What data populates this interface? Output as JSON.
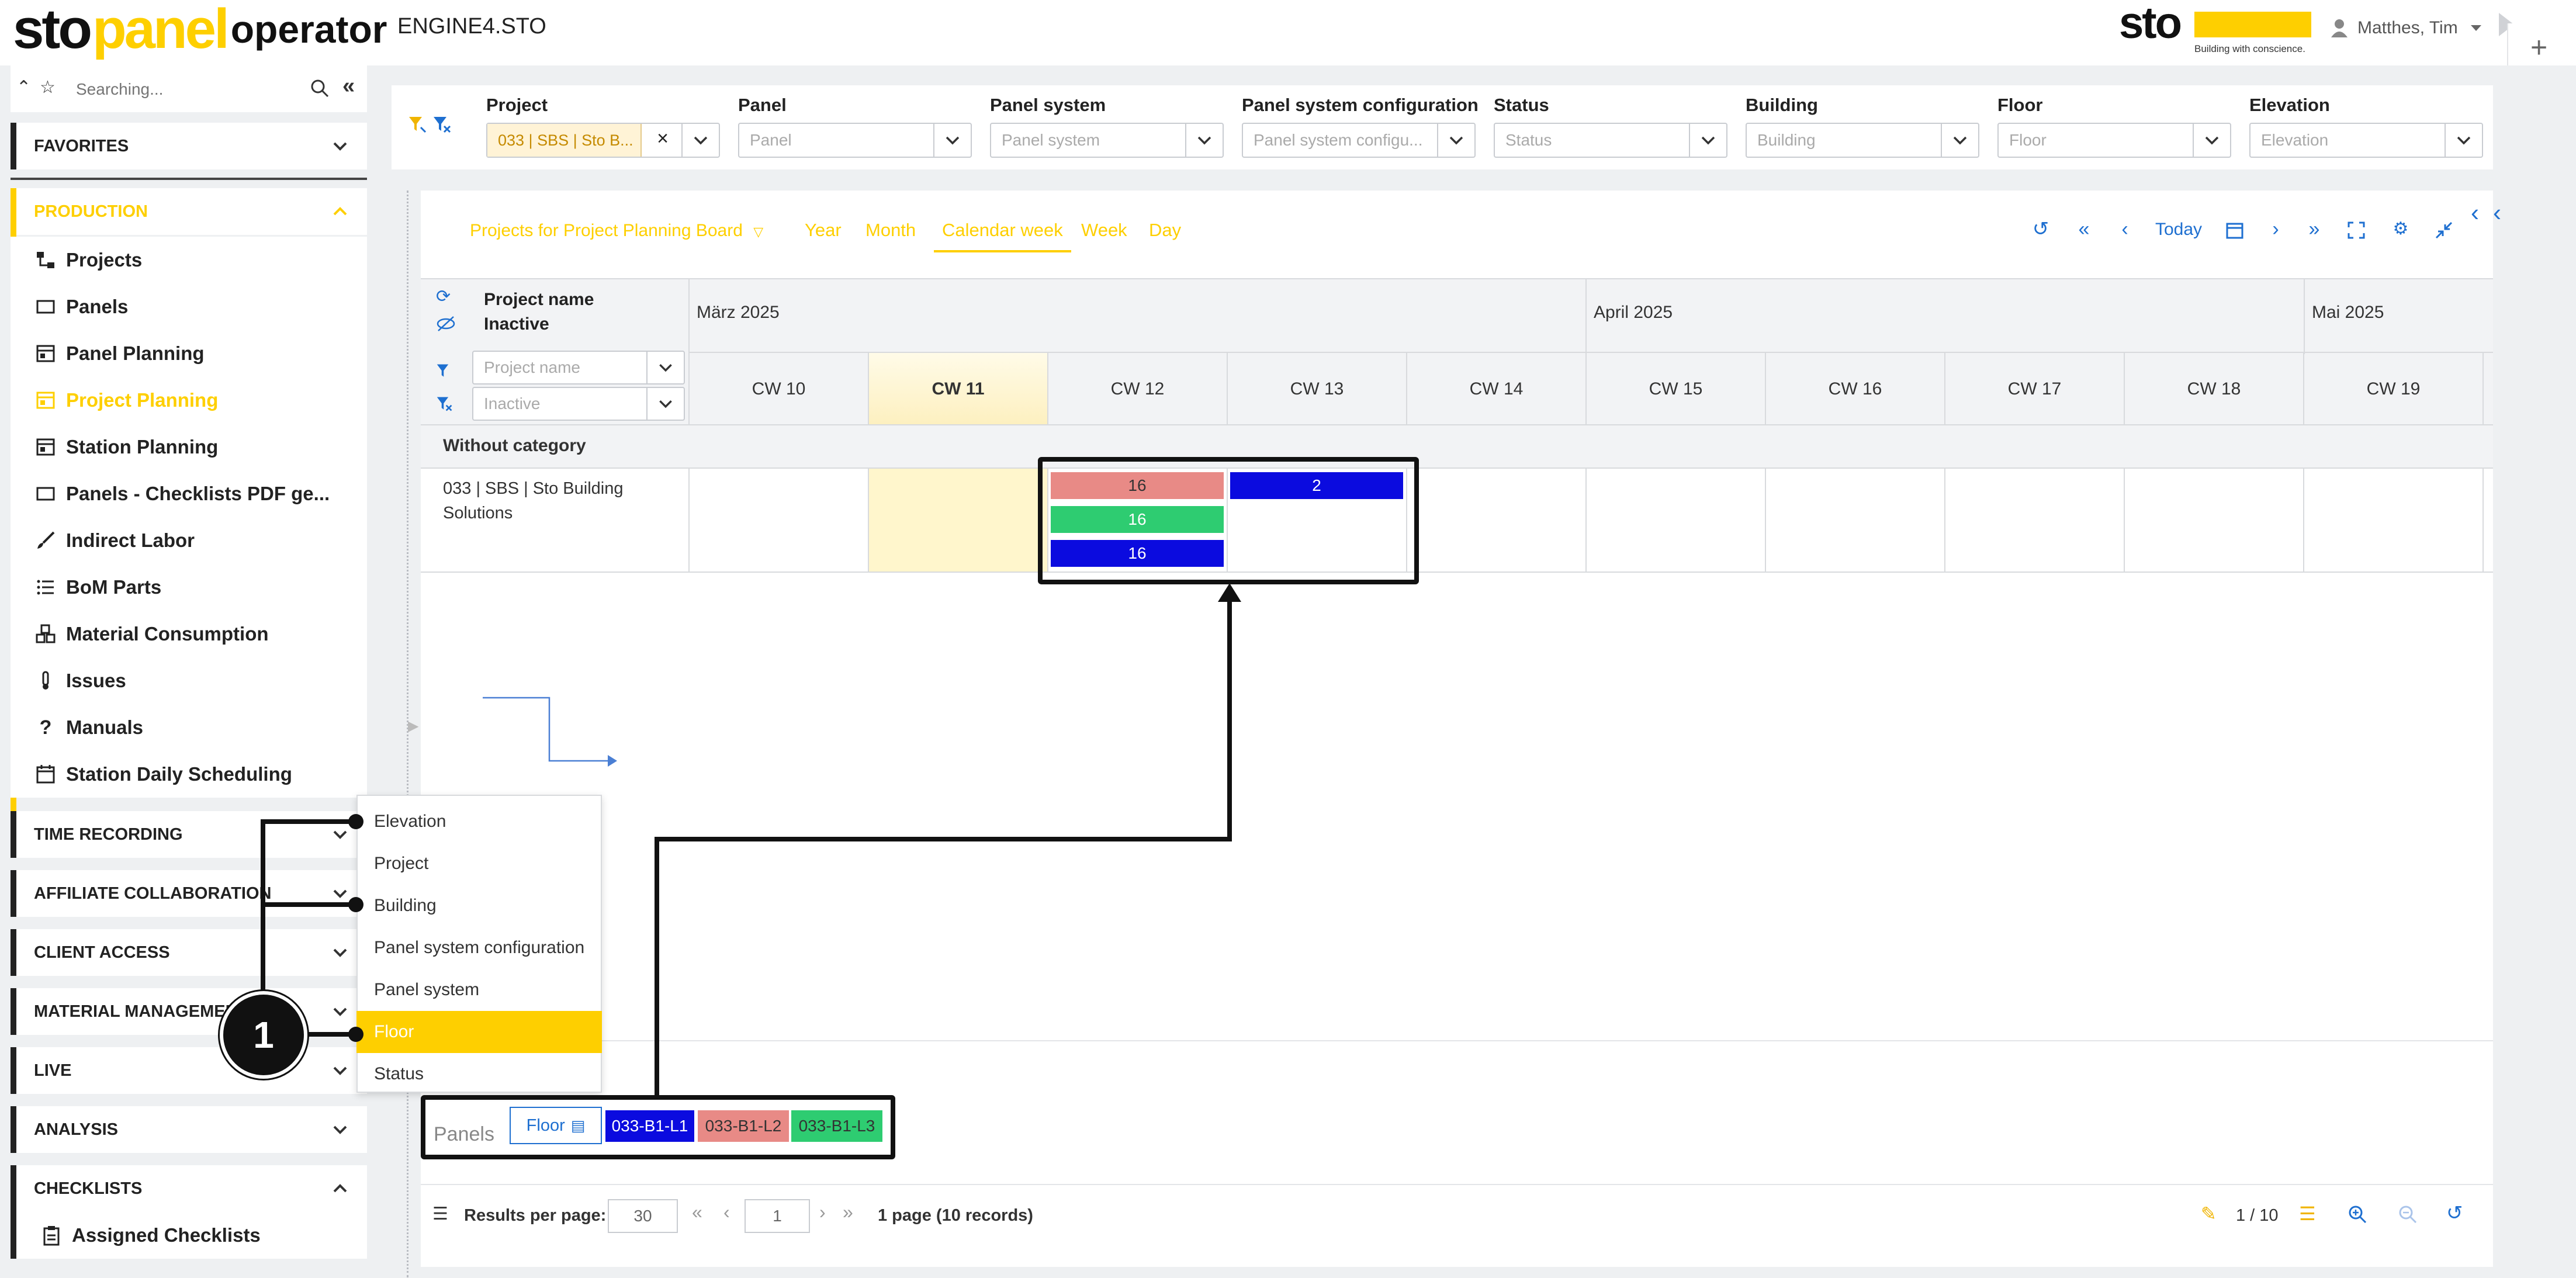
{
  "header": {
    "logo_sto": "sto",
    "logo_panel": "panel",
    "logo_operator": "operator",
    "app_title": "ENGINE4.STO",
    "brand_logo": "sto",
    "brand_tagline": "Building with conscience.",
    "user_name": "Matthes, Tim"
  },
  "sidebar": {
    "search_placeholder": "Searching...",
    "favorites": "FAVORITES",
    "production": "PRODUCTION",
    "items": [
      {
        "label": "Projects",
        "icon": "projects-icon"
      },
      {
        "label": "Panels",
        "icon": "panel-icon"
      },
      {
        "label": "Panel Planning",
        "icon": "planning-icon"
      },
      {
        "label": "Project Planning",
        "icon": "planning-icon"
      },
      {
        "label": "Station Planning",
        "icon": "planning-icon"
      },
      {
        "label": "Panels - Checklists PDF ge...",
        "icon": "panel-icon"
      },
      {
        "label": "Indirect Labor",
        "icon": "brush-icon"
      },
      {
        "label": "BoM Parts",
        "icon": "list-icon"
      },
      {
        "label": "Material Consumption",
        "icon": "cubes-icon"
      },
      {
        "label": "Issues",
        "icon": "thermometer-icon"
      },
      {
        "label": "Manuals",
        "icon": "question-icon"
      },
      {
        "label": "Station Daily Scheduling",
        "icon": "calendar-icon"
      }
    ],
    "sections": [
      "TIME RECORDING",
      "AFFILIATE COLLABORATION",
      "CLIENT ACCESS",
      "MATERIAL MANAGEMENT",
      "LIVE",
      "ANALYSIS",
      "CHECKLISTS"
    ],
    "assigned_checklists": "Assigned Checklists"
  },
  "filters": [
    {
      "label": "Project",
      "value": "033 | SBS | Sto B...",
      "placeholder": ""
    },
    {
      "label": "Panel",
      "value": "",
      "placeholder": "Panel"
    },
    {
      "label": "Panel system",
      "value": "",
      "placeholder": "Panel system"
    },
    {
      "label": "Panel system configuration",
      "value": "",
      "placeholder": "Panel system configu..."
    },
    {
      "label": "Status",
      "value": "",
      "placeholder": "Status"
    },
    {
      "label": "Building",
      "value": "",
      "placeholder": "Building"
    },
    {
      "label": "Floor",
      "value": "",
      "placeholder": "Floor"
    },
    {
      "label": "Elevation",
      "value": "",
      "placeholder": "Elevation"
    }
  ],
  "toolbar": {
    "view_select": "Projects for Project Planning Board",
    "views": [
      "Year",
      "Month",
      "Calendar week",
      "Week",
      "Day"
    ],
    "active_view": "Calendar week",
    "today": "Today"
  },
  "grid": {
    "col_project_name": "Project name",
    "col_inactive": "Inactive",
    "filter_project_placeholder": "Project name",
    "filter_inactive_placeholder": "Inactive",
    "months": [
      "März 2025",
      "April 2025",
      "Mai 2025"
    ],
    "weeks": [
      "CW 10",
      "CW 11",
      "CW 12",
      "CW 13",
      "CW 14",
      "CW 15",
      "CW 16",
      "CW 17",
      "CW 18",
      "CW 19"
    ],
    "current_week": "CW 11",
    "category": "Without category",
    "row_label_line1": "033 | SBS | Sto Building",
    "row_label_line2": "Solutions",
    "bars": [
      {
        "week": "CW 12",
        "value": "16",
        "color": "#e88a86"
      },
      {
        "week": "CW 12",
        "value": "16",
        "color": "#2ecc71"
      },
      {
        "week": "CW 12",
        "value": "16",
        "color": "#0b0bdf"
      },
      {
        "week": "CW 13",
        "value": "2",
        "color": "#0b0bdf"
      }
    ]
  },
  "dropdown": {
    "options": [
      "Elevation",
      "Project",
      "Building",
      "Panel system configuration",
      "Panel system",
      "Floor",
      "Status"
    ],
    "selected": "Floor"
  },
  "panels": {
    "label": "Panels",
    "group_by": "Floor",
    "legend": [
      {
        "label": "033-B1-L1",
        "color": "#0b0bdf"
      },
      {
        "label": "033-B1-L2",
        "color": "#e88a86"
      },
      {
        "label": "033-B1-L3",
        "color": "#2ecc71"
      }
    ]
  },
  "pager": {
    "results_label": "Results per page:",
    "per_page": "30",
    "page": "1",
    "summary": "1 page (10 records)",
    "counter": "1 / 10"
  },
  "callout": {
    "number": "1"
  }
}
